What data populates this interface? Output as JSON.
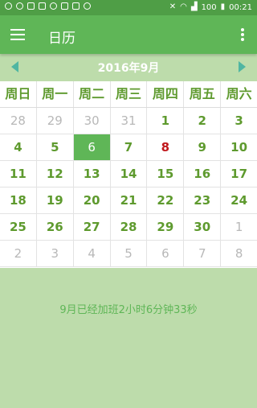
{
  "status": {
    "battery": "100",
    "time": "00:21",
    "icons": [
      "clock-icon",
      "clock-icon",
      "image-icon",
      "grid-icon",
      "weibo-icon",
      "usb-icon",
      "phone-icon",
      "circle-icon"
    ],
    "right_icons": [
      "vibrate-off-icon",
      "wifi-icon",
      "signal-icon",
      "battery-icon"
    ]
  },
  "appbar": {
    "title": "日历"
  },
  "calendar": {
    "month_title": "2016年9月",
    "weekdays": [
      "周日",
      "周一",
      "周二",
      "周三",
      "周四",
      "周五",
      "周六"
    ],
    "weeks": [
      [
        {
          "day": "28",
          "state": "other"
        },
        {
          "day": "29",
          "state": "other"
        },
        {
          "day": "30",
          "state": "other"
        },
        {
          "day": "31",
          "state": "other"
        },
        {
          "day": "1",
          "state": "normal"
        },
        {
          "day": "2",
          "state": "normal"
        },
        {
          "day": "3",
          "state": "normal"
        }
      ],
      [
        {
          "day": "4",
          "state": "normal"
        },
        {
          "day": "5",
          "state": "normal"
        },
        {
          "day": "6",
          "state": "today"
        },
        {
          "day": "7",
          "state": "normal"
        },
        {
          "day": "8",
          "state": "holiday"
        },
        {
          "day": "9",
          "state": "normal"
        },
        {
          "day": "10",
          "state": "normal"
        }
      ],
      [
        {
          "day": "11",
          "state": "normal"
        },
        {
          "day": "12",
          "state": "normal"
        },
        {
          "day": "13",
          "state": "normal"
        },
        {
          "day": "14",
          "state": "normal"
        },
        {
          "day": "15",
          "state": "normal"
        },
        {
          "day": "16",
          "state": "normal"
        },
        {
          "day": "17",
          "state": "normal"
        }
      ],
      [
        {
          "day": "18",
          "state": "normal"
        },
        {
          "day": "19",
          "state": "normal"
        },
        {
          "day": "20",
          "state": "normal"
        },
        {
          "day": "21",
          "state": "normal"
        },
        {
          "day": "22",
          "state": "normal"
        },
        {
          "day": "23",
          "state": "normal"
        },
        {
          "day": "24",
          "state": "normal"
        }
      ],
      [
        {
          "day": "25",
          "state": "normal"
        },
        {
          "day": "26",
          "state": "normal"
        },
        {
          "day": "27",
          "state": "normal"
        },
        {
          "day": "28",
          "state": "normal"
        },
        {
          "day": "29",
          "state": "normal"
        },
        {
          "day": "30",
          "state": "normal"
        },
        {
          "day": "1",
          "state": "other"
        }
      ],
      [
        {
          "day": "2",
          "state": "other"
        },
        {
          "day": "3",
          "state": "other"
        },
        {
          "day": "4",
          "state": "other"
        },
        {
          "day": "5",
          "state": "other"
        },
        {
          "day": "6",
          "state": "other"
        },
        {
          "day": "7",
          "state": "other"
        },
        {
          "day": "8",
          "state": "other"
        }
      ]
    ]
  },
  "summary": {
    "text": "9月已经加班2小时6分钟33秒"
  },
  "colors": {
    "accent": "#5fb657",
    "status_bar": "#4f9e46",
    "background": "#bddcab",
    "day_text": "#5e9a2e",
    "holiday": "#c0181c",
    "arrows": "#4fb6a2"
  }
}
